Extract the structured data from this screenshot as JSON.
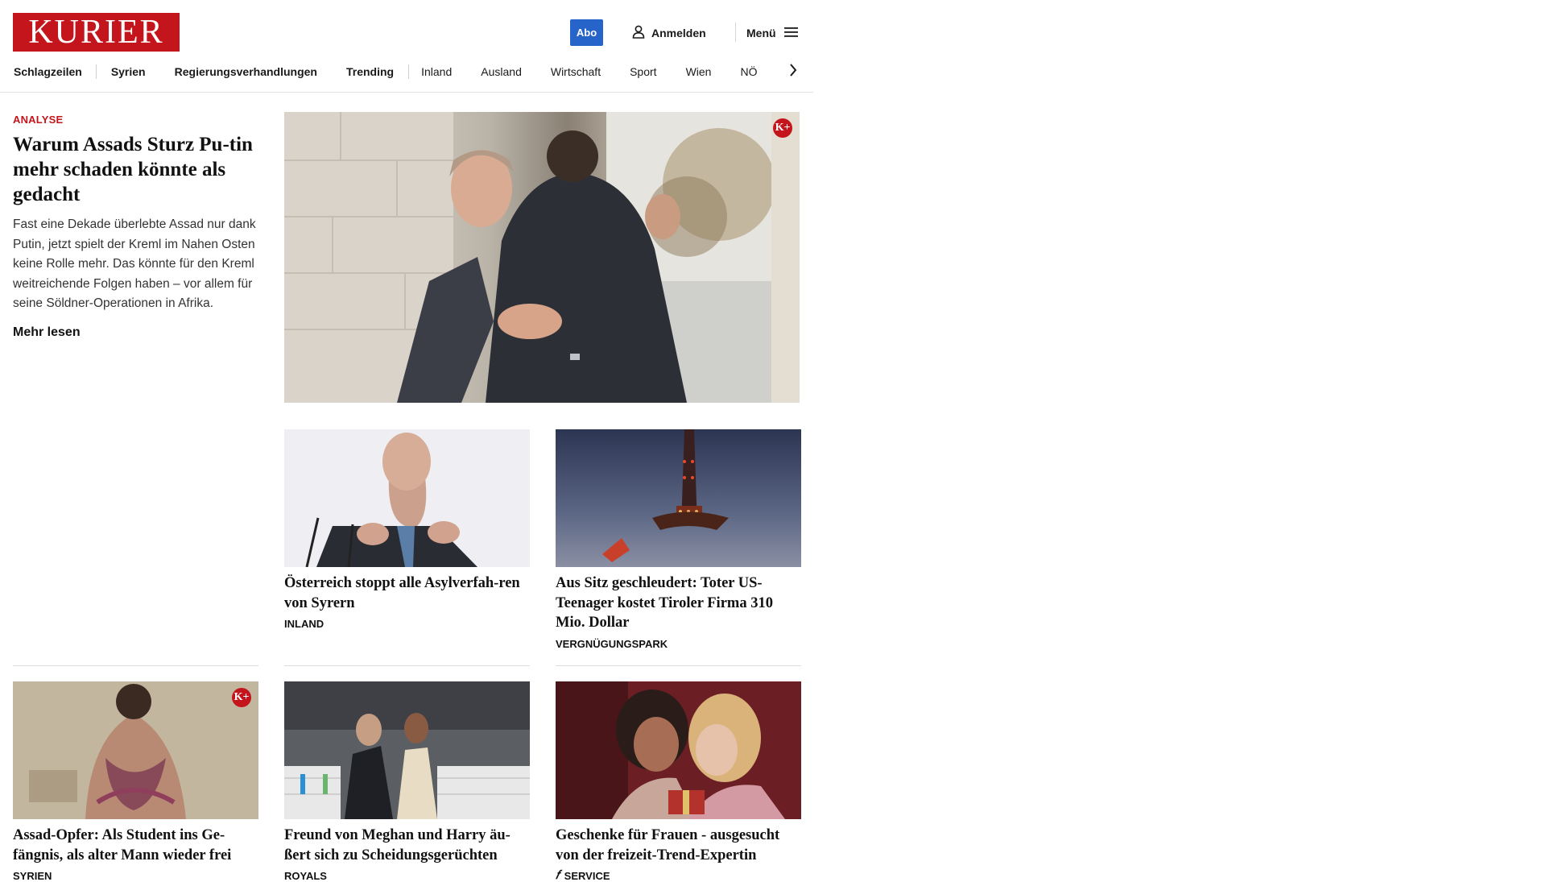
{
  "header": {
    "logo_text": "KURIER",
    "abo_label": "Abo",
    "login_label": "Anmelden",
    "menu_label": "Menü",
    "brand_color": "#c4151c",
    "accent_color": "#2764c9"
  },
  "nav": {
    "items": [
      "Schlagzeilen",
      "Syrien",
      "Regierungsverhandlungen",
      "Trending",
      "Inland",
      "Ausland",
      "Wirtschaft",
      "Sport",
      "Wien",
      "NÖ"
    ]
  },
  "lead": {
    "kicker": "ANALYSE",
    "title": "Warum Assads Sturz Pu-tin mehr schaden könnte als gedacht",
    "teaser": "Fast eine Dekade überlebte Assad nur dank Putin, jetzt spielt der Kreml im Nahen Osten keine Rolle mehr. Das könnte für den Kreml weitreichende Folgen haben – vor allem für seine Söldner-Operationen in Afrika.",
    "more_label": "Mehr lesen",
    "badge": "K+"
  },
  "cards": [
    {
      "title": "Österreich stoppt alle Asylverfah-ren von Syrern",
      "kicker": "INLAND"
    },
    {
      "title": "Aus Sitz geschleudert: Toter US-Teenager kostet Tiroler Firma 310 Mio. Dollar",
      "kicker": "VERGNÜGUNGSPARK"
    },
    {
      "title": "Assad-Opfer: Als Student ins Ge-fängnis, als alter Mann wieder frei",
      "kicker": "SYRIEN",
      "badge": "K+"
    },
    {
      "title": "Freund von Meghan und Harry äu-ßert sich zu Scheidungsgerüchten",
      "kicker": "ROYALS"
    },
    {
      "title": "Geschenke für Frauen - ausgesucht von der freizeit-Trend-Expertin",
      "kicker": "SERVICE",
      "kicker_icon": "freizeit-f-icon"
    }
  ]
}
